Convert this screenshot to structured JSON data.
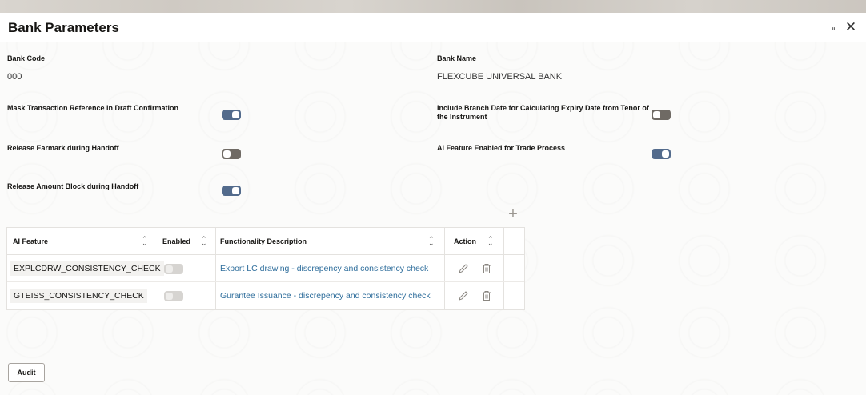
{
  "window": {
    "title": "Bank Parameters"
  },
  "fields": {
    "bank_code": {
      "label": "Bank Code",
      "value": "000"
    },
    "bank_name": {
      "label": "Bank Name",
      "value": "FLEXCUBE UNIVERSAL BANK"
    },
    "mask_txn_ref": {
      "label": "Mask Transaction Reference in Draft Confirmation",
      "state": "on"
    },
    "include_branch_date": {
      "label_line1": "Include Branch Date for Calculating Expiry Date from Tenor of",
      "label_line2": "the Instrument",
      "state": "off"
    },
    "release_earmark": {
      "label": "Release Earmark during Handoff",
      "state": "off"
    },
    "ai_feature_enabled": {
      "label": "AI Feature Enabled for Trade Process",
      "state": "on"
    },
    "release_amount_block": {
      "label": "Release Amount Block during Handoff",
      "state": "on"
    }
  },
  "grid": {
    "add_label": "+",
    "columns": [
      "AI Feature",
      "Enabled",
      "Functionality Description",
      "Action"
    ],
    "rows": [
      {
        "feature": "EXPLCDRW_CONSISTENCY_CHECK",
        "enabled": false,
        "description": "Export LC drawing - discrepency and consistency check"
      },
      {
        "feature": "GTEISS_CONSISTENCY_CHECK",
        "enabled": false,
        "description": "Gurantee Issuance - discrepency and consistency check"
      }
    ]
  },
  "footer": {
    "audit_label": "Audit"
  },
  "icons": {
    "sort": "sort-icon",
    "edit": "pencil-icon",
    "delete": "trash-icon",
    "minimize": "minimize-icon",
    "close": "close-icon"
  },
  "colors": {
    "toggle_on": "#536b8c",
    "toggle_off": "#6f6a64",
    "link": "#2f6e9c"
  }
}
